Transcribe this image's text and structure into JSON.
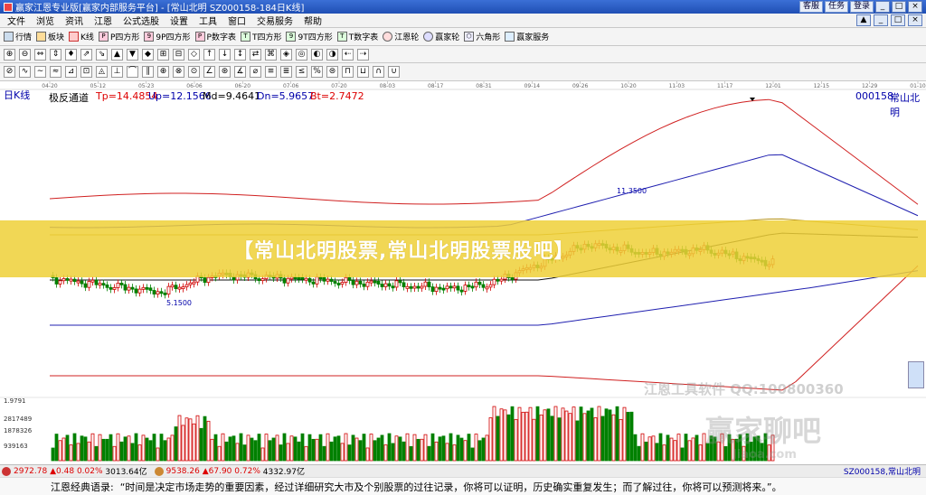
{
  "window": {
    "title": "赢家江恩专业版[赢家内部服务平台] - [常山北明  SZ000158-184日K线]",
    "right_buttons": [
      "客服",
      "任务",
      "登录"
    ],
    "win_controls": [
      "_",
      "□",
      "×"
    ]
  },
  "menu": {
    "items": [
      "文件",
      "浏览",
      "资讯",
      "江恩",
      "公式选股",
      "设置",
      "工具",
      "窗口",
      "交易服务",
      "帮助"
    ],
    "right": [
      "▲",
      "_",
      "□",
      "×"
    ]
  },
  "toolbar1": {
    "items": [
      "行情",
      "板块",
      "K线",
      "P四方形",
      "9P四方形",
      "P数字表",
      "T四方形",
      "9T四方形",
      "T数字表",
      "江恩轮",
      "赢家轮",
      "六角形",
      "赢家服务"
    ]
  },
  "toolbar2": {
    "glyphs": [
      "⊕",
      "⊖",
      "⇔",
      "⇕",
      "♦",
      "⇗",
      "⇘",
      "▲",
      "▼",
      "◆",
      "⊞",
      "⊟",
      "◇",
      "↑",
      "↓",
      "↕",
      "⇄",
      "⌘",
      "◈",
      "◎",
      "◐",
      "◑",
      "⇠",
      "⇢"
    ]
  },
  "toolbar3": {
    "glyphs": [
      "⊘",
      "∿",
      "∼",
      "≈",
      "⊿",
      "⊡",
      "◬",
      "⊥",
      "⌒",
      "∥",
      "⊕",
      "⊗",
      "⊙",
      "∠",
      "⊛",
      "∡",
      "⌀",
      "≡",
      "≣",
      "≤",
      "%",
      "⊜",
      "⊓",
      "⊔",
      "∩",
      "∪"
    ]
  },
  "chart": {
    "period_label": "日K线",
    "indicator_name": "极反通道",
    "tp": "Tp=14.4854",
    "up": "Up=12.1566",
    "md": "Md=9.4641",
    "dn": "Dn=5.9657",
    "bt": "Bt=2.7472",
    "stock_code": "000158",
    "stock_name": "常山北明",
    "high_label": "11.3500",
    "low_label": "5.1500",
    "dates": [
      "04-20",
      "05-12",
      "05-23",
      "06-06",
      "06-20",
      "07-06",
      "07-20",
      "08-03",
      "08-17",
      "08-31",
      "09-14",
      "09-26",
      "10-20",
      "11-03",
      "11-17",
      "12-01",
      "12-15",
      "12-29",
      "01-10"
    ],
    "volume_ticks": [
      "1.9791",
      "2817489",
      "1878326",
      "939163"
    ],
    "colors": {
      "up": "#d00000",
      "down": "#008000",
      "upper": "#d02020",
      "mid": "#2020b0",
      "mid2": "#101010",
      "gold": "#b89418"
    }
  },
  "banner": {
    "text": "【常山北明股票,常山北明股票股吧】"
  },
  "watermark": {
    "line1": "江恩工具软件 QQ:100800360",
    "line2": "赢家聊吧",
    "line3": "Jiaoa.com"
  },
  "status": {
    "idx1": "2972.78",
    "idx1_chg": "▲0.48",
    "idx1_pct": "0.02%",
    "idx1_amt": "3013.64亿",
    "idx2": "9538.26",
    "idx2_chg": "▲67.90",
    "idx2_pct": "0.72%",
    "idx2_amt": "4332.97亿",
    "right_code": "SZ000158,常山北明"
  },
  "quote": {
    "label": "江恩经典语录:",
    "text": "“时间是决定市场走势的重要因素，经过详细研究大市及个别股票的过往记录，你将可以证明，历史确实重复发生；而了解过往，你将可以预测将来。”。"
  }
}
